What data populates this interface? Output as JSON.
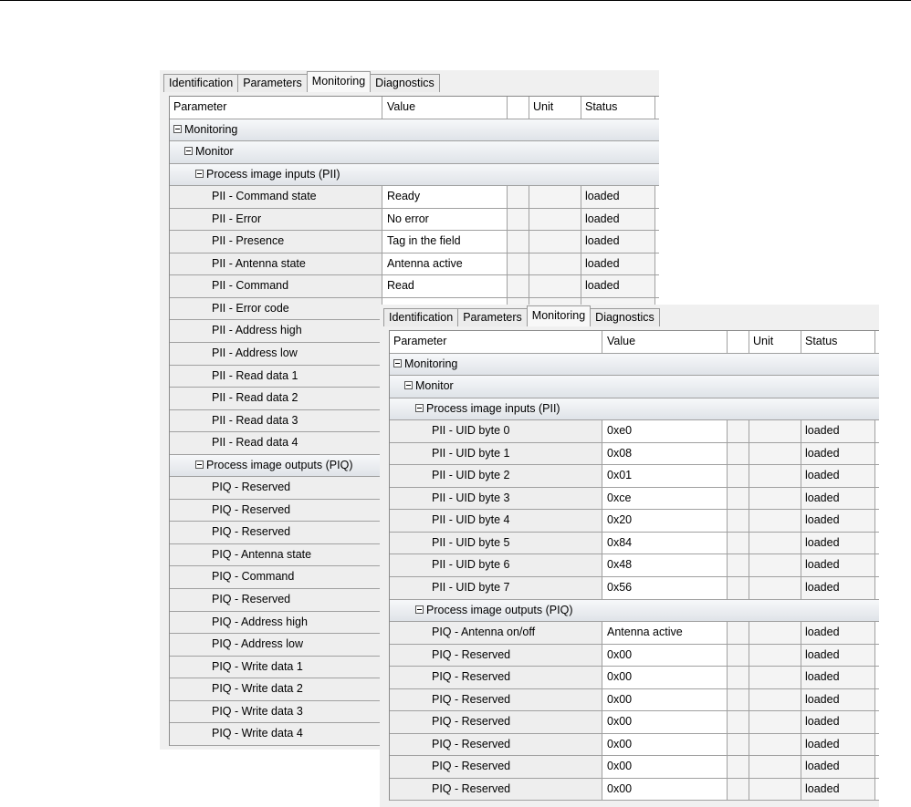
{
  "panelA": {
    "tabs": [
      "Identification",
      "Parameters",
      "Monitoring",
      "Diagnostics"
    ],
    "active_tab": "Monitoring",
    "headers": {
      "parameter": "Parameter",
      "value": "Value",
      "unit": "Unit",
      "status": "Status"
    },
    "groups": {
      "monitoring": "Monitoring",
      "monitor": "Monitor",
      "pii": "Process image inputs (PII)",
      "piq": "Process image outputs (PIQ)"
    },
    "pii_rows": [
      {
        "param": "PII -  Command state",
        "value": "Ready",
        "status": "loaded"
      },
      {
        "param": "PII -  Error",
        "value": "No error",
        "status": "loaded"
      },
      {
        "param": "PII -  Presence",
        "value": "Tag in the field",
        "status": "loaded"
      },
      {
        "param": "PII -  Antenna state",
        "value": "Antenna active",
        "status": "loaded"
      },
      {
        "param": "PII -  Command",
        "value": "Read",
        "status": "loaded"
      },
      {
        "param": "PII -  Error code",
        "value": "",
        "status": ""
      },
      {
        "param": "PII -  Address high",
        "value": "",
        "status": ""
      },
      {
        "param": "PII -  Address low",
        "value": "",
        "status": ""
      },
      {
        "param": "PII -  Read data 1",
        "value": "",
        "status": ""
      },
      {
        "param": "PII -  Read data 2",
        "value": "",
        "status": ""
      },
      {
        "param": "PII -  Read data 3",
        "value": "",
        "status": ""
      },
      {
        "param": "PII -  Read data 4",
        "value": "",
        "status": ""
      }
    ],
    "piq_rows": [
      {
        "param": "PIQ - Reserved",
        "value": "",
        "status": ""
      },
      {
        "param": "PIQ - Reserved",
        "value": "",
        "status": ""
      },
      {
        "param": "PIQ - Reserved",
        "value": "",
        "status": ""
      },
      {
        "param": "PIQ -  Antenna state",
        "value": "",
        "status": ""
      },
      {
        "param": "PIQ -  Command",
        "value": "",
        "status": ""
      },
      {
        "param": "PIQ -  Reserved",
        "value": "",
        "status": ""
      },
      {
        "param": "PIQ -  Address high",
        "value": "",
        "status": ""
      },
      {
        "param": "PIQ -  Address low",
        "value": "",
        "status": ""
      },
      {
        "param": "PIQ -  Write data 1",
        "value": "",
        "status": ""
      },
      {
        "param": "PIQ -  Write data 2",
        "value": "",
        "status": ""
      },
      {
        "param": "PIQ -  Write data 3",
        "value": "",
        "status": ""
      },
      {
        "param": "PIQ -  Write data 4",
        "value": "",
        "status": ""
      }
    ]
  },
  "panelB": {
    "tabs": [
      "Identification",
      "Parameters",
      "Monitoring",
      "Diagnostics"
    ],
    "active_tab": "Monitoring",
    "headers": {
      "parameter": "Parameter",
      "value": "Value",
      "unit": "Unit",
      "status": "Status"
    },
    "groups": {
      "monitoring": "Monitoring",
      "monitor": "Monitor",
      "pii": "Process image inputs (PII)",
      "piq": "Process image outputs (PIQ)"
    },
    "pii_rows": [
      {
        "param": "PII -  UID byte 0",
        "value": "0xe0",
        "status": "loaded"
      },
      {
        "param": "PII -  UID byte 1",
        "value": "0x08",
        "status": "loaded"
      },
      {
        "param": "PII -  UID byte 2",
        "value": "0x01",
        "status": "loaded"
      },
      {
        "param": "PII -  UID byte 3",
        "value": "0xce",
        "status": "loaded"
      },
      {
        "param": "PII -  UID byte 4",
        "value": "0x20",
        "status": "loaded"
      },
      {
        "param": "PII -  UID byte 5",
        "value": "0x84",
        "status": "loaded"
      },
      {
        "param": "PII -  UID byte 6",
        "value": "0x48",
        "status": "loaded"
      },
      {
        "param": "PII -  UID byte 7",
        "value": "0x56",
        "status": "loaded"
      }
    ],
    "piq_rows": [
      {
        "param": "PIQ -  Antenna on/off",
        "value": "Antenna active",
        "status": "loaded"
      },
      {
        "param": "PIQ -  Reserved",
        "value": "0x00",
        "status": "loaded"
      },
      {
        "param": "PIQ -  Reserved",
        "value": "0x00",
        "status": "loaded"
      },
      {
        "param": "PIQ -  Reserved",
        "value": "0x00",
        "status": "loaded"
      },
      {
        "param": "PIQ -  Reserved",
        "value": "0x00",
        "status": "loaded"
      },
      {
        "param": "PIQ -  Reserved",
        "value": "0x00",
        "status": "loaded"
      },
      {
        "param": "PIQ -  Reserved",
        "value": "0x00",
        "status": "loaded"
      },
      {
        "param": "PIQ -  Reserved",
        "value": "0x00",
        "status": "loaded"
      }
    ]
  }
}
